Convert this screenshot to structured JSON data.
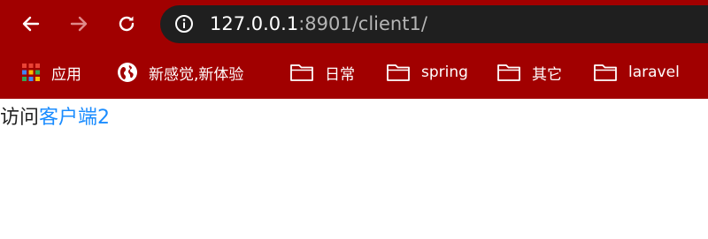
{
  "browser": {
    "url_host": "127.0.0.1",
    "url_rest": ":8901/client1/"
  },
  "bookmarks": [
    {
      "label": "应用",
      "icon": "apps-grid-icon"
    },
    {
      "label": "新感觉,新体验",
      "icon": "globe-icon"
    },
    {
      "label": "日常",
      "icon": "folder-icon"
    },
    {
      "label": "spring",
      "icon": "folder-icon"
    },
    {
      "label": "其它",
      "icon": "folder-icon"
    },
    {
      "label": "laravel",
      "icon": "folder-icon"
    }
  ],
  "page": {
    "prefix_text": "访问",
    "link_text": "客户端2"
  },
  "colors": {
    "toolbar": "#a10000",
    "omnibox": "#1f1f1f",
    "link": "#1a8cff"
  }
}
